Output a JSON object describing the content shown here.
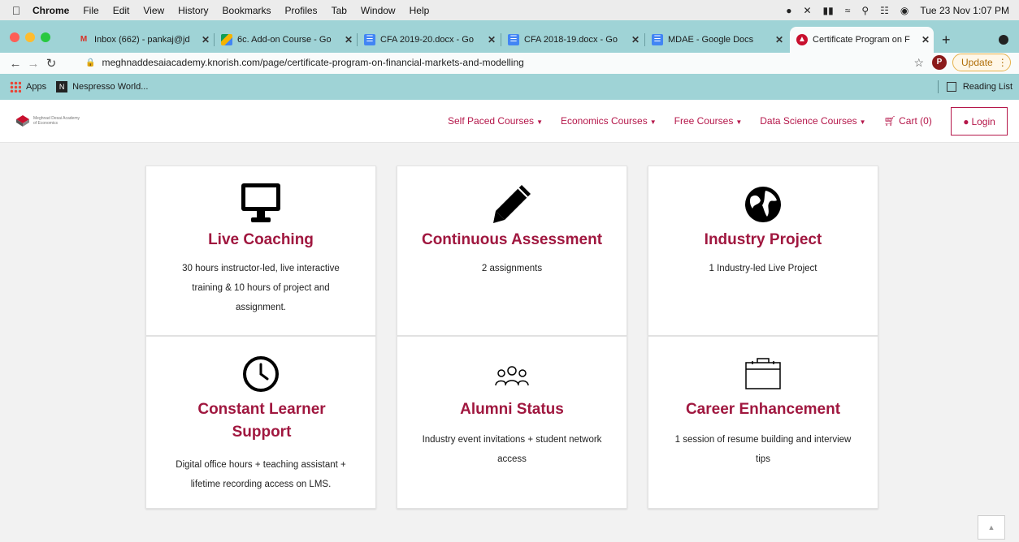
{
  "macos_menubar": {
    "app": "Chrome",
    "menus": [
      "File",
      "Edit",
      "View",
      "History",
      "Bookmarks",
      "Profiles",
      "Tab",
      "Window",
      "Help"
    ],
    "clock": "Tue 23 Nov  1:07 PM"
  },
  "tabs": [
    {
      "label": "Inbox (662) - pankaj@jd",
      "favicon": "gmail-icon",
      "color": "#d93025"
    },
    {
      "label": "6c. Add-on Course - Go",
      "favicon": "drive-icon",
      "color": "#f4b400"
    },
    {
      "label": "CFA 2019-20.docx - Go",
      "favicon": "docs-icon",
      "color": "#4285f4"
    },
    {
      "label": "CFA 2018-19.docx - Go",
      "favicon": "docs-icon",
      "color": "#4285f4"
    },
    {
      "label": "MDAE - Google Docs",
      "favicon": "docs-icon",
      "color": "#4285f4"
    },
    {
      "label": "Certificate Program on F",
      "favicon": "knorish-icon",
      "color": "#c8102e",
      "active": true
    }
  ],
  "address_bar": {
    "url": "meghnaddesaiacademy.knorish.com/page/certificate-program-on-financial-markets-and-modelling",
    "profile_initial": "P",
    "update_label": "Update"
  },
  "bookmarks": {
    "items": [
      "Apps",
      "Nespresso World..."
    ],
    "reading_list": "Reading List"
  },
  "site": {
    "logo_text": "Meghnad Desai Academy of Economics",
    "nav": [
      {
        "label": "Self Paced Courses",
        "dropdown": true
      },
      {
        "label": "Economics Courses",
        "dropdown": true
      },
      {
        "label": "Free Courses",
        "dropdown": true
      },
      {
        "label": "Data Science Courses",
        "dropdown": true
      }
    ],
    "cart": "Cart (0)",
    "login": "Login",
    "accent": "#b5174a"
  },
  "features": [
    {
      "title": "Live Coaching",
      "desc": "30 hours instructor-led, live interactive training & 10 hours of project and assignment.",
      "icon": "monitor-icon"
    },
    {
      "title": "Continuous Assessment",
      "desc": "2 assignments",
      "icon": "pencil-icon"
    },
    {
      "title": "Industry Project",
      "desc": "1 Industry-led Live Project",
      "icon": "globe-icon"
    },
    {
      "title": "Constant Learner Support",
      "desc": "Digital office hours + teaching assistant + lifetime recording access on LMS.",
      "icon": "clock-icon"
    },
    {
      "title": "Alumni Status",
      "desc": "Industry event invitations + student network access",
      "icon": "users-icon"
    },
    {
      "title": "Career Enhancement",
      "desc": "1 session of resume building and interview tips",
      "icon": "briefcase-icon"
    }
  ],
  "scroll_top_icon": "caret-up-icon"
}
